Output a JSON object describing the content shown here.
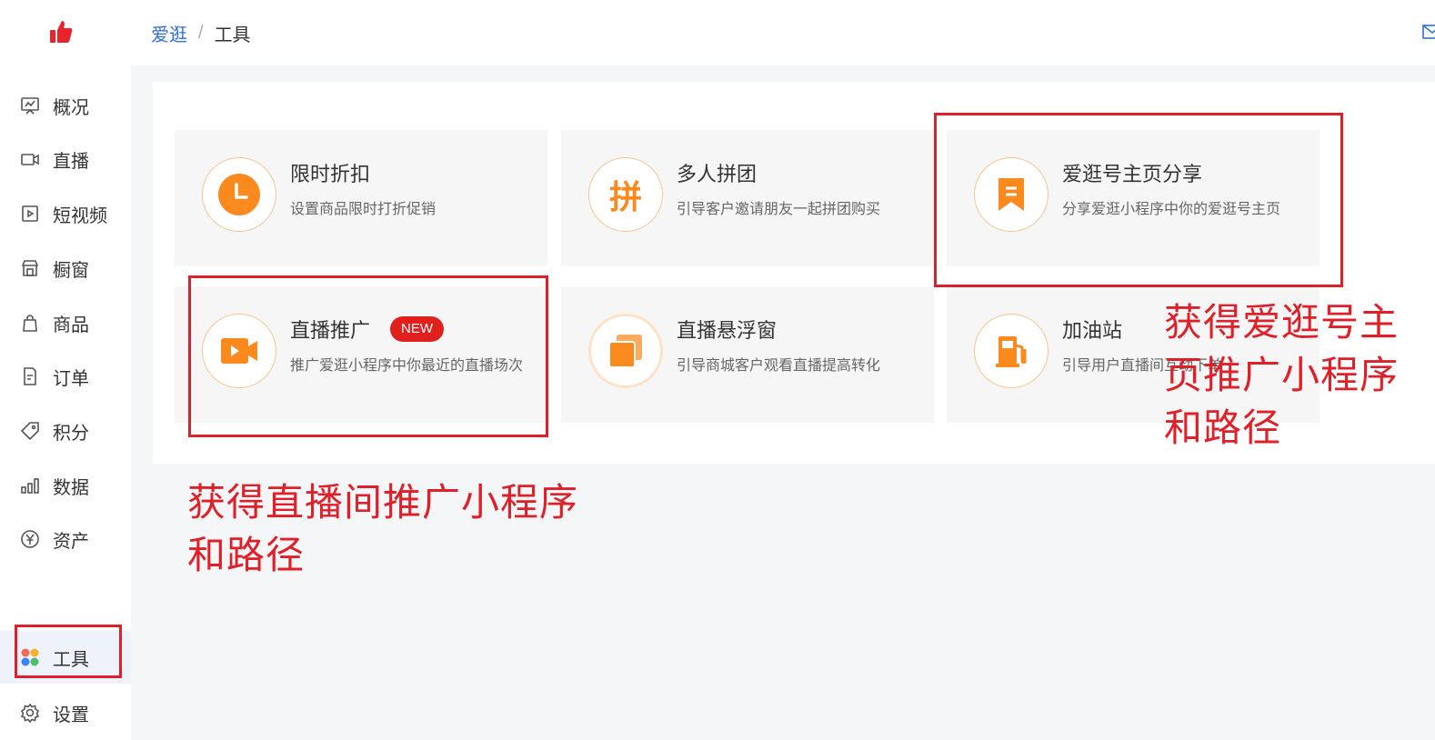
{
  "sidebar": {
    "logo_icon": "thumbs-up-icon",
    "items": [
      {
        "label": "概况",
        "icon": "overview-icon"
      },
      {
        "label": "直播",
        "icon": "live-camera-icon"
      },
      {
        "label": "短视频",
        "icon": "video-play-icon"
      },
      {
        "label": "橱窗",
        "icon": "shop-icon"
      },
      {
        "label": "商品",
        "icon": "bag-icon"
      },
      {
        "label": "订单",
        "icon": "order-icon"
      },
      {
        "label": "积分",
        "icon": "tag-icon"
      },
      {
        "label": "数据",
        "icon": "bar-chart-icon"
      },
      {
        "label": "资产",
        "icon": "yuan-icon"
      },
      {
        "label": "工具",
        "icon": "tools-grid-icon",
        "active": true
      },
      {
        "label": "设置",
        "icon": "gear-icon"
      }
    ]
  },
  "header": {
    "breadcrumb": {
      "root": "爱逛",
      "separator": "/",
      "current": "工具"
    },
    "mail_icon": "mail-icon"
  },
  "tools": [
    {
      "title": "限时折扣",
      "desc": "设置商品限时打折促销",
      "icon": "clock-icon"
    },
    {
      "title": "多人拼团",
      "desc": "引导客户邀请朋友一起拼团购买",
      "icon": "pin-text-icon",
      "icon_text": "拼"
    },
    {
      "title": "爱逛号主页分享",
      "desc": "分享爱逛小程序中你的爱逛号主页",
      "icon": "bookmark-icon"
    },
    {
      "title": "直播推广",
      "badge": "NEW",
      "desc": "推广爱逛小程序中你最近的直播场次",
      "icon": "video-camera-icon"
    },
    {
      "title": "直播悬浮窗",
      "desc": "引导商城客户观看直播提高转化",
      "icon": "stacked-window-icon"
    },
    {
      "title": "加油站",
      "desc": "引导用户直播间互动下单",
      "icon": "fuel-pump-icon"
    }
  ],
  "annotations": {
    "homepage_note": "获得爱逛号主页推广小程序和路径",
    "live_note": "获得直播间推广小程序和路径"
  },
  "colors": {
    "accent_orange": "#fb8a1e",
    "link_blue": "#2f6fd6",
    "annotation_red": "#e02028",
    "badge_red": "#e0201c"
  }
}
